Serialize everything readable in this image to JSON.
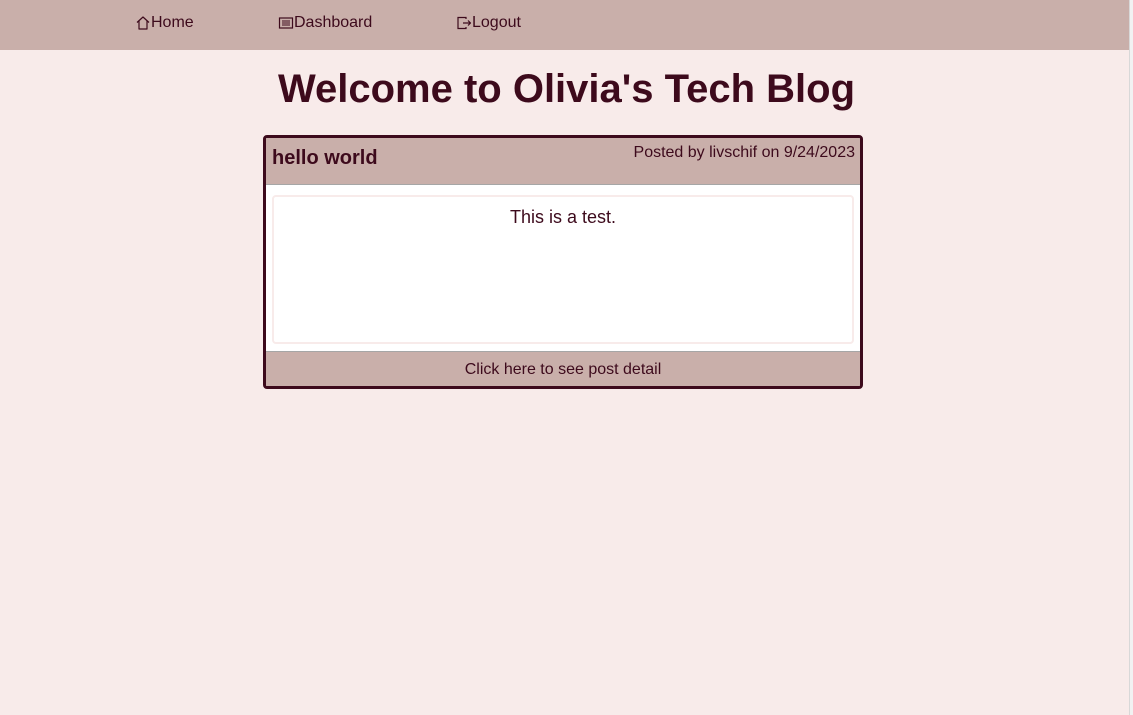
{
  "nav": {
    "home": {
      "label": "Home",
      "icon": "home-icon"
    },
    "dashboard": {
      "label": "Dashboard",
      "icon": "list-icon"
    },
    "logout": {
      "label": "Logout",
      "icon": "logout-icon"
    }
  },
  "page": {
    "title": "Welcome to Olivia's Tech Blog"
  },
  "post": {
    "title": "hello world",
    "meta": "Posted by livschif on 9/24/2023",
    "content": "This is a test.",
    "detail_link": "Click here to see post detail"
  },
  "colors": {
    "nav_background": "#c9afaa",
    "page_background": "#f8ebea",
    "text": "#3d0a1c",
    "card_border": "#3d0a1c",
    "card_body": "#ffffff"
  }
}
